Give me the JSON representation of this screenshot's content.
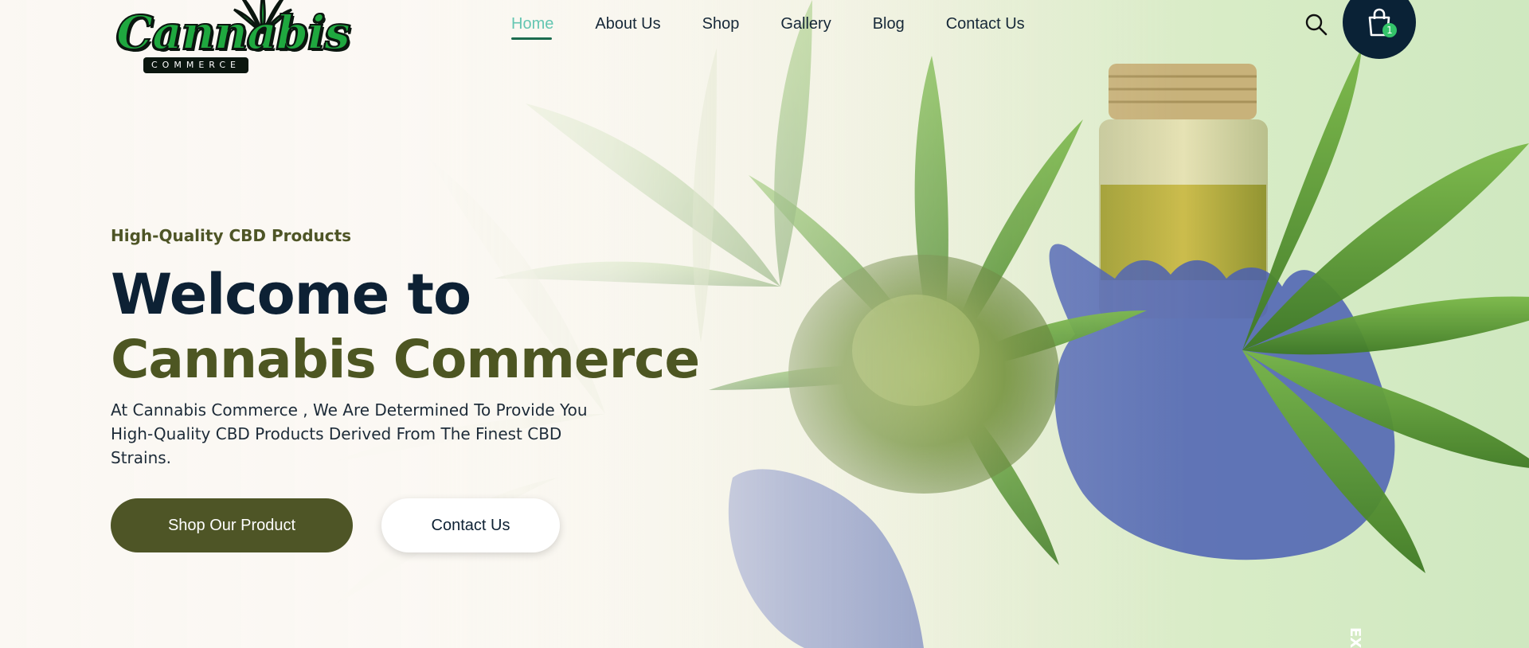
{
  "brand": {
    "name": "Cannabis",
    "tagline": "COMMERCE"
  },
  "nav": {
    "items": [
      {
        "label": "Home",
        "active": true
      },
      {
        "label": "About Us",
        "active": false
      },
      {
        "label": "Shop",
        "active": false
      },
      {
        "label": "Gallery",
        "active": false
      },
      {
        "label": "Blog",
        "active": false
      },
      {
        "label": "Contact Us",
        "active": false
      }
    ]
  },
  "header": {
    "search_icon": "search-icon",
    "cart_icon": "shopping-bag-icon",
    "cart_count": "1"
  },
  "hero": {
    "kicker": "High-Quality CBD Products",
    "title_line1": "Welcome to",
    "title_line2": "Cannabis Commerce",
    "description": "At Cannabis Commerce , We Are Determined To Provide You High-Quality CBD Products Derived From The Finest CBD Strains.",
    "primary_button": "Shop Our Product",
    "secondary_button": "Contact Us",
    "side_label": "EX"
  },
  "colors": {
    "brand_green": "#1fa83f",
    "olive": "#4e5526",
    "navy": "#0a2236",
    "nav_active": "#64c6b2",
    "nav_underline": "#1b6b4e",
    "badge": "#34c46a"
  }
}
